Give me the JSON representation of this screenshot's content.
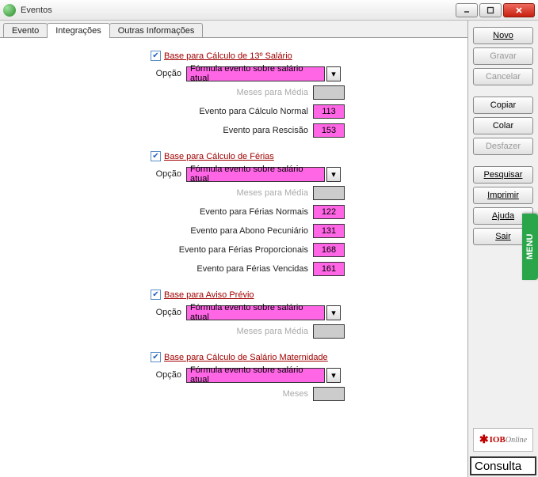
{
  "window": {
    "title": "Eventos"
  },
  "tabs": {
    "evento": "Evento",
    "integracoes": "Integrações",
    "outras": "Outras Informações"
  },
  "sections": {
    "decimo": {
      "title": "Base para Cálculo de 13º Salário",
      "opcao_label": "Opção",
      "opcao_value": "Fórmula evento sobre salário atual",
      "meses_label": "Meses para Média",
      "rows": {
        "calc_normal": {
          "label": "Evento para Cálculo Normal",
          "value": "113"
        },
        "rescisao": {
          "label": "Evento para Rescisão",
          "value": "153"
        }
      }
    },
    "ferias": {
      "title": "Base para Cálculo de Férias",
      "opcao_label": "Opção",
      "opcao_value": "Fórmula evento sobre salário atual",
      "meses_label": "Meses para Média",
      "rows": {
        "normais": {
          "label": "Evento para Férias Normais",
          "value": "122"
        },
        "abono": {
          "label": "Evento para Abono Pecuniário",
          "value": "131"
        },
        "proporcionais": {
          "label": "Evento para Férias Proporcionais",
          "value": "168"
        },
        "vencidas": {
          "label": "Evento para Férias Vencidas",
          "value": "161"
        }
      }
    },
    "aviso": {
      "title": "Base para Aviso Prévio",
      "opcao_label": "Opção",
      "opcao_value": "Fórmula evento sobre salário atual",
      "meses_label": "Meses para Média"
    },
    "maternidade": {
      "title": "Base para Cálculo de Salário Maternidade",
      "opcao_label": "Opção",
      "opcao_value": "Fórmula evento sobre salário atual",
      "meses_label": "Meses"
    }
  },
  "buttons": {
    "novo": "Novo",
    "gravar": "Gravar",
    "cancelar": "Cancelar",
    "copiar": "Copiar",
    "colar": "Colar",
    "desfazer": "Desfazer",
    "pesquisar": "Pesquisar",
    "imprimir": "Imprimir",
    "ajuda": "Ajuda",
    "sair": "Sair"
  },
  "logo": {
    "brand": "IOB",
    "suffix": "Online"
  },
  "consulta": "Consulta",
  "menu_tab": "MENU"
}
